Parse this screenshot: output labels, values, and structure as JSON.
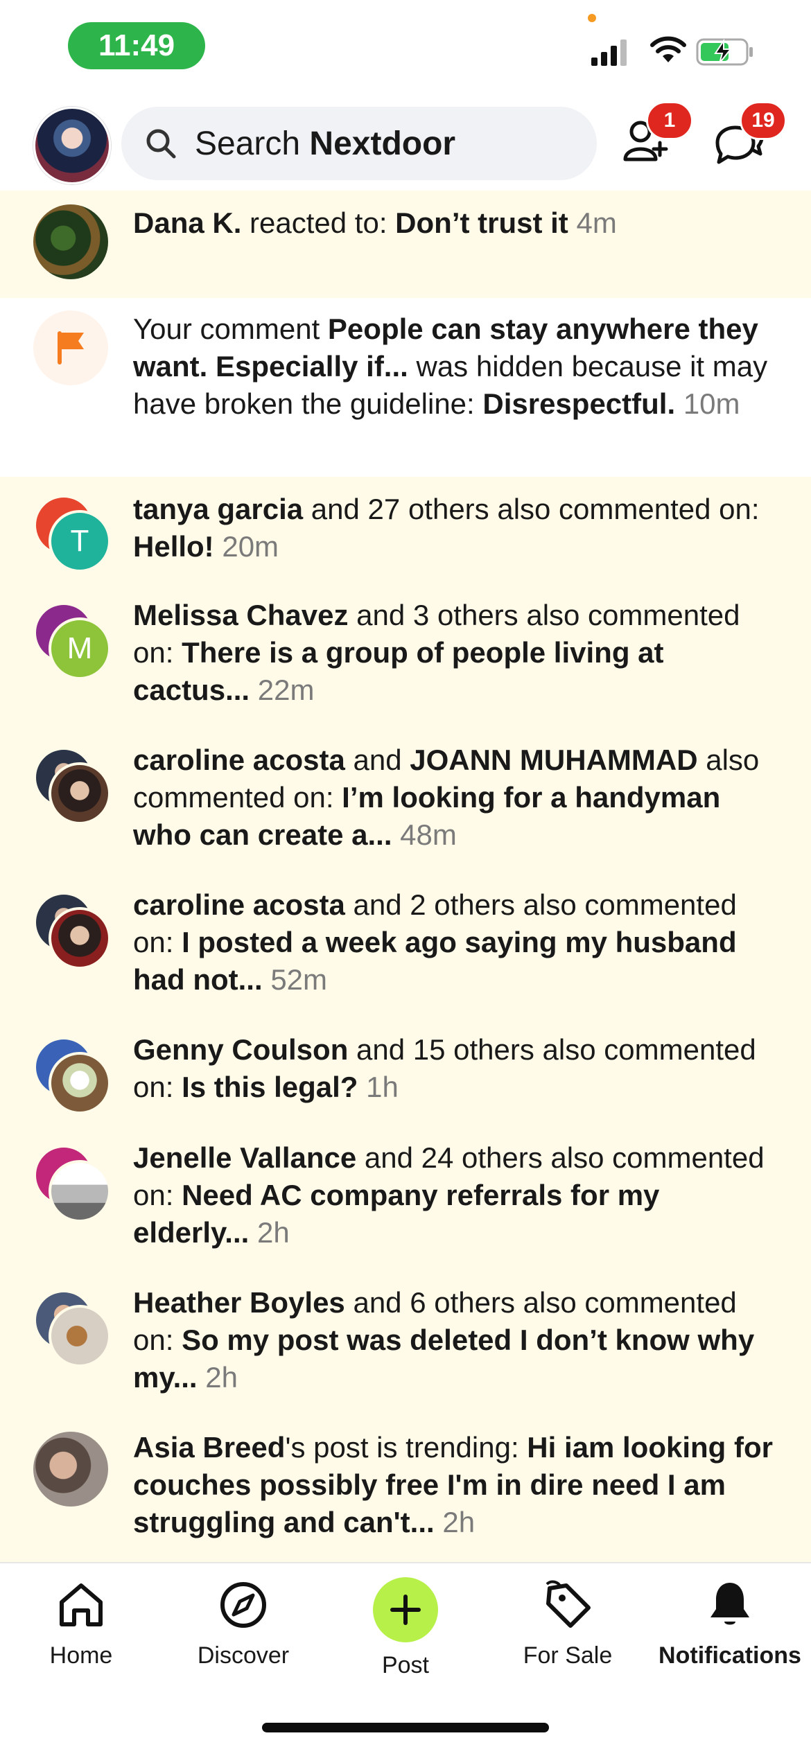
{
  "status_bar": {
    "time": "11:49"
  },
  "header": {
    "search_placeholder_prefix": "Search ",
    "search_placeholder_brand": "Nextdoor",
    "friend_requests_badge": "1",
    "messages_badge": "19"
  },
  "notifications": [
    {
      "name": "Dana K.",
      "middle": " reacted to: ",
      "subject": "Don’t trust it",
      "time": "4m",
      "state": "unread"
    },
    {
      "prefix": "Your comment ",
      "subject": "People can stay anywhere they want. Especially if...",
      "middle": " was hidden because it may have broken the guideline: ",
      "reason": "Disrespectful.",
      "time": "10m",
      "state": "read"
    },
    {
      "name": "tanya garcia",
      "middle": " and 27 others also commented on: ",
      "subject": "Hello!",
      "time": "20m",
      "state": "unread",
      "initial": "T"
    },
    {
      "name": "Melissa Chavez",
      "middle": " and 3 others also commented on: ",
      "subject": "There is a group of people living at cactus...",
      "time": "22m",
      "state": "unread",
      "initial": "M"
    },
    {
      "name": "caroline acosta",
      "middle": " and ",
      "name2": "JOANN MUHAMMAD",
      "middle2": " also commented on: ",
      "subject": "I’m looking for a handyman who can create a...",
      "time": "48m",
      "state": "unread"
    },
    {
      "name": "caroline acosta",
      "middle": " and 2 others also commented on: ",
      "subject": "I posted a week ago saying my husband had not...",
      "time": "52m",
      "state": "unread"
    },
    {
      "name": "Genny Coulson",
      "middle": " and 15 others also commented on: ",
      "subject": "Is this legal?",
      "time": "1h",
      "state": "unread"
    },
    {
      "name": "Jenelle Vallance",
      "middle": " and 24 others also commented on: ",
      "subject": "Need AC company referrals for my elderly...",
      "time": "2h",
      "state": "unread"
    },
    {
      "name": "Heather Boyles",
      "middle": " and 6 others also commented on: ",
      "subject": "So my post was deleted I don’t know why my...",
      "time": "2h",
      "state": "unread"
    },
    {
      "name": "Asia Breed",
      "middle": "'s post is trending: ",
      "subject": "Hi iam looking for couches possibly free I'm in dire need I am struggling and can't...",
      "time": "2h",
      "state": "unread"
    }
  ],
  "bottom_nav": {
    "home": "Home",
    "discover": "Discover",
    "post": "Post",
    "for_sale": "For Sale",
    "notifications": "Notifications"
  },
  "colors": {
    "accent_green": "#b8f04a",
    "badge_red": "#e0271f",
    "unread_bg": "#fffbe8",
    "flag_orange": "#f57c1f"
  }
}
